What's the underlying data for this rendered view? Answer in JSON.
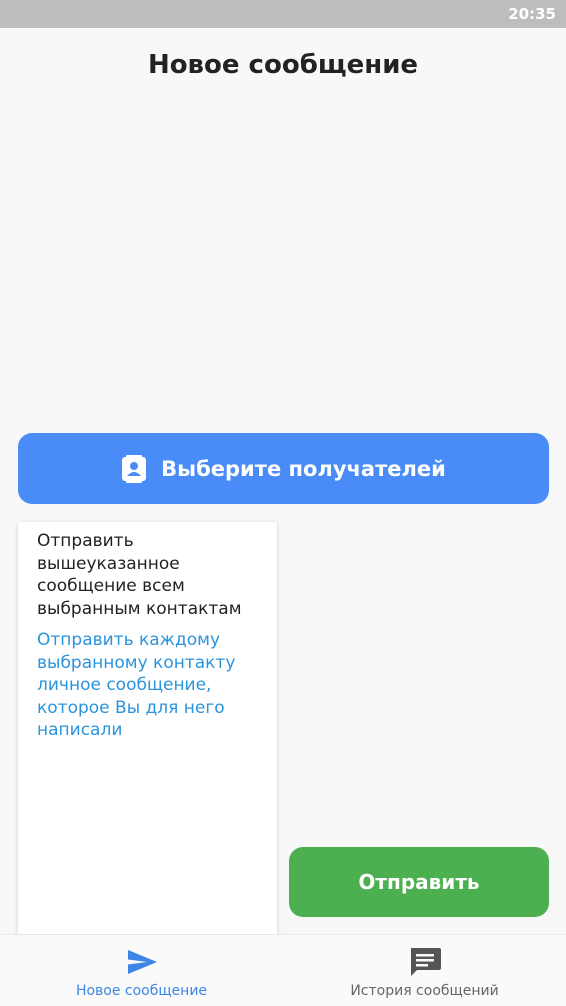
{
  "status_bar": {
    "time": "20:35"
  },
  "header": {
    "title": "Новое сообщение"
  },
  "recipients_button": {
    "label": "Выберите получателей",
    "icon": "contact-icon"
  },
  "send_mode_menu": {
    "items": [
      {
        "label": "Отправить вышеуказанное сообщение всем выбранным контактам"
      },
      {
        "label": "Отправить каждому выбранному контакту личное сообщение, которое Вы для него написали"
      }
    ]
  },
  "send_button": {
    "label": "Отправить"
  },
  "bottom_nav": {
    "tabs": [
      {
        "label": "Новое сообщение",
        "icon": "send-icon",
        "active": true
      },
      {
        "label": "История сообщений",
        "icon": "chat-icon",
        "active": false
      }
    ]
  },
  "colors": {
    "accent_blue": "#4a8cf7",
    "send_green": "#4caf50",
    "menu_link_blue": "#2a94dd",
    "active_tab": "#3d86e5",
    "status_bar": "#bdbdbd"
  }
}
